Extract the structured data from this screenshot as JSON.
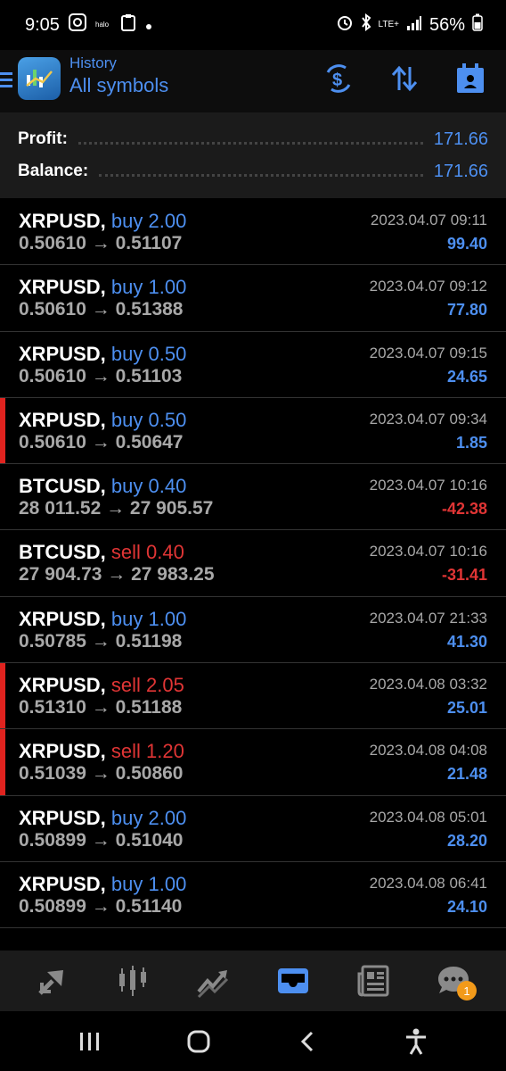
{
  "status": {
    "time": "9:05",
    "battery": "56%",
    "network": "LTE+"
  },
  "header": {
    "subtitle": "History",
    "title": "All symbols",
    "accent": "#4d8ff0"
  },
  "summary": {
    "profit_label": "Profit:",
    "profit_value": "171.66",
    "balance_label": "Balance:",
    "balance_value": "171.66"
  },
  "deals": [
    {
      "symbol": "XRPUSD,",
      "side": "buy",
      "type": "buy 2.00",
      "prices": "0.50610 → 0.51107",
      "time": "2023.04.07 09:11",
      "profit": "99.40",
      "flag": false
    },
    {
      "symbol": "XRPUSD,",
      "side": "buy",
      "type": "buy 1.00",
      "prices": "0.50610 → 0.51388",
      "time": "2023.04.07 09:12",
      "profit": "77.80",
      "flag": false
    },
    {
      "symbol": "XRPUSD,",
      "side": "buy",
      "type": "buy 0.50",
      "prices": "0.50610 → 0.51103",
      "time": "2023.04.07 09:15",
      "profit": "24.65",
      "flag": false
    },
    {
      "symbol": "XRPUSD,",
      "side": "buy",
      "type": "buy 0.50",
      "prices": "0.50610 → 0.50647",
      "time": "2023.04.07 09:34",
      "profit": "1.85",
      "flag": true
    },
    {
      "symbol": "BTCUSD,",
      "side": "buy",
      "type": "buy 0.40",
      "prices": "28 011.52 → 27 905.57",
      "time": "2023.04.07 10:16",
      "profit": "-42.38",
      "flag": false
    },
    {
      "symbol": "BTCUSD,",
      "side": "sell",
      "type": "sell 0.40",
      "prices": "27 904.73 → 27 983.25",
      "time": "2023.04.07 10:16",
      "profit": "-31.41",
      "flag": false
    },
    {
      "symbol": "XRPUSD,",
      "side": "buy",
      "type": "buy 1.00",
      "prices": "0.50785 → 0.51198",
      "time": "2023.04.07 21:33",
      "profit": "41.30",
      "flag": false
    },
    {
      "symbol": "XRPUSD,",
      "side": "sell",
      "type": "sell 2.05",
      "prices": "0.51310 → 0.51188",
      "time": "2023.04.08 03:32",
      "profit": "25.01",
      "flag": true
    },
    {
      "symbol": "XRPUSD,",
      "side": "sell",
      "type": "sell 1.20",
      "prices": "0.51039 → 0.50860",
      "time": "2023.04.08 04:08",
      "profit": "21.48",
      "flag": true
    },
    {
      "symbol": "XRPUSD,",
      "side": "buy",
      "type": "buy 2.00",
      "prices": "0.50899 → 0.51040",
      "time": "2023.04.08 05:01",
      "profit": "28.20",
      "flag": false
    },
    {
      "symbol": "XRPUSD,",
      "side": "buy",
      "type": "buy 1.00",
      "prices": "0.50899 → 0.51140",
      "time": "2023.04.08 06:41",
      "profit": "24.10",
      "flag": false
    }
  ],
  "tabs": [
    {
      "name": "tab-quotes",
      "icon": "quotes-icon",
      "active": false
    },
    {
      "name": "tab-chart",
      "icon": "candlestick-icon",
      "active": false
    },
    {
      "name": "tab-trade",
      "icon": "trend-icon",
      "active": false
    },
    {
      "name": "tab-history",
      "icon": "inbox-icon",
      "active": true
    },
    {
      "name": "tab-news",
      "icon": "news-icon",
      "active": false
    },
    {
      "name": "tab-messages",
      "icon": "chat-icon",
      "active": false,
      "badge": "1"
    }
  ]
}
